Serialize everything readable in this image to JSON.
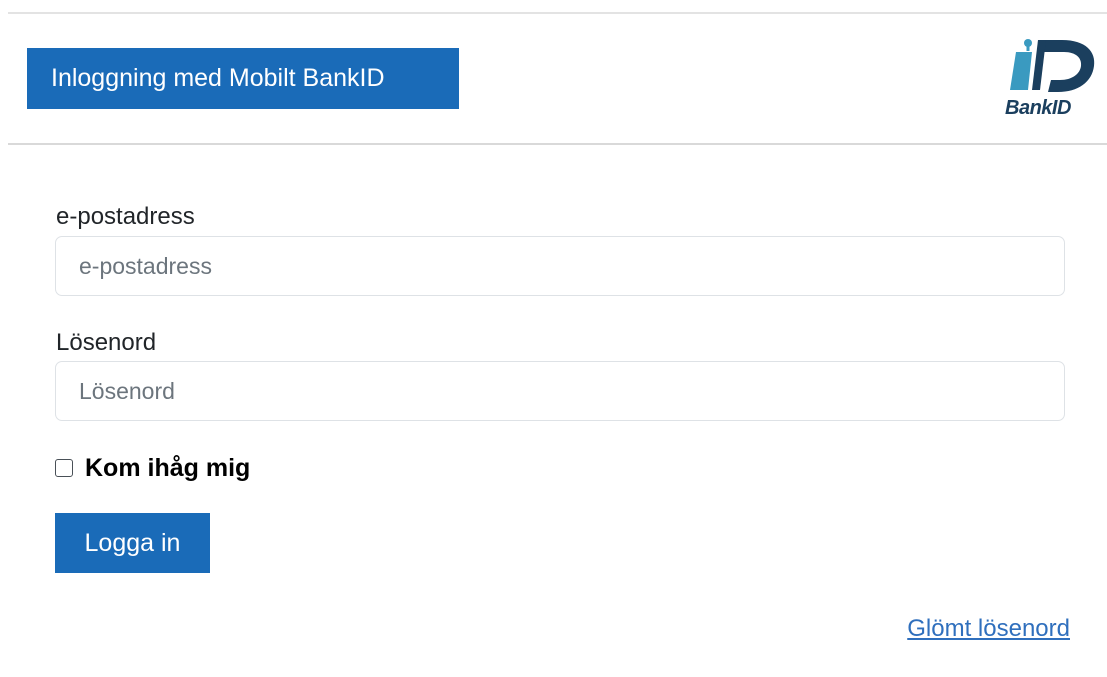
{
  "colors": {
    "brand": "#1a6bb8",
    "link": "#2f6fbd"
  },
  "header": {
    "bankid_button_label": "Inloggning med Mobilt BankID",
    "logo_text": "BankID"
  },
  "form": {
    "email": {
      "label": "e-postadress",
      "placeholder": "e-postadress",
      "value": ""
    },
    "password": {
      "label": "Lösenord",
      "placeholder": "Lösenord",
      "value": ""
    },
    "remember_me": {
      "label": "Kom ihåg mig",
      "checked": false
    },
    "submit_label": "Logga in",
    "forgot_password_label": "Glömt lösenord"
  }
}
